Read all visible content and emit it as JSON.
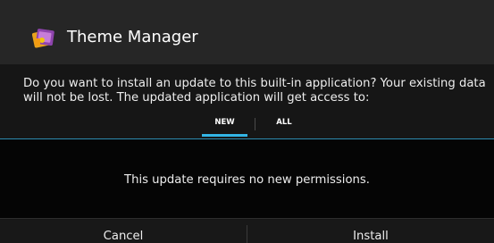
{
  "dialog": {
    "title": "Theme Manager",
    "app_icon": "theme-manager-icon",
    "message": "Do you want to install an update to this built-in application? Your existing data will not be lost. The updated application will get access to:",
    "tabs": [
      {
        "label": "NEW",
        "selected": true
      },
      {
        "label": "ALL",
        "selected": false
      }
    ],
    "permissions_text": "This update requires no new permissions.",
    "buttons": {
      "cancel_label": "Cancel",
      "install_label": "Install"
    },
    "colors": {
      "accent": "#33b5e5",
      "title_bar": "#262626",
      "background": "#050505"
    }
  }
}
